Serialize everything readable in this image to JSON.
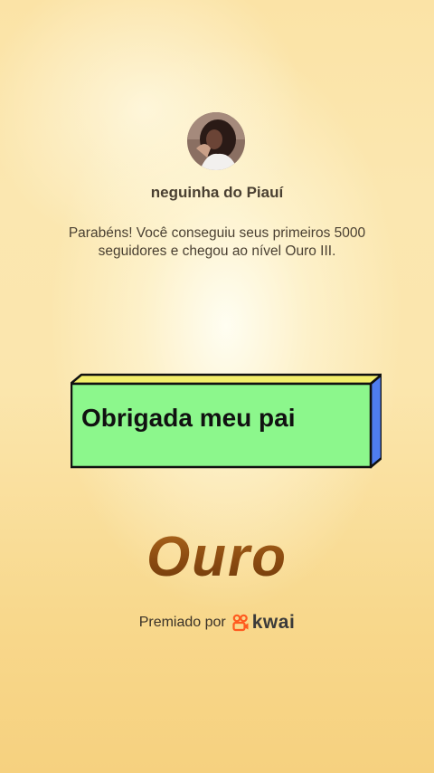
{
  "profile": {
    "username": "neguinha do Piauí"
  },
  "message": "Parabéns! Você conseguiu seus primeiros 5000 seguidores e chegou ao nível Ouro III.",
  "banner": {
    "text": "Obrigada meu pai",
    "colors": {
      "face": "#8cf78c",
      "top": "#f3ee6a",
      "side": "#4f7df0"
    }
  },
  "level": {
    "name": "Ouro",
    "color": "#8a4a10"
  },
  "award": {
    "label": "Premiado por",
    "brand": "kwai",
    "logo_icon": "kwai-logo-icon",
    "logo_color": "#ff5a1f"
  }
}
